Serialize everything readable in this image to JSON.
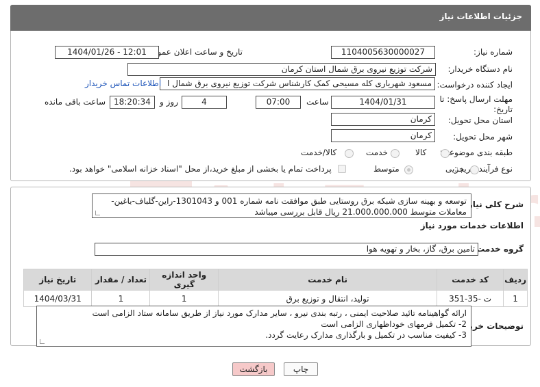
{
  "header": {
    "title": "جزئیات اطلاعات نیاز"
  },
  "form": {
    "need_number_label": "شماره نیاز:",
    "need_number": "1104005630000027",
    "announce_label": "تاریخ و ساعت اعلان عمومی:",
    "announce_value": "1404/01/26 - 12:01",
    "buyer_org_label": "نام دستگاه خریدار:",
    "buyer_org": "شرکت توزیع نیروی برق شمال استان کرمان",
    "creator_label": "ایجاد کننده درخواست:",
    "creator": "مسعود شهریاری کله مسیحی کمک کارشناس شرکت توزیع نیروی برق شمال ا",
    "contact_link": "اطلاعات تماس خریدار",
    "deadline_label_1": "مهلت ارسال پاسخ: تا",
    "deadline_label_2": "تاریخ:",
    "deadline_date": "1404/01/31",
    "time_label": "ساعت",
    "deadline_time": "07:00",
    "day_and_label": "روز و",
    "days": "4",
    "remaining_time": "18:20:34",
    "remaining_label": "ساعت باقی مانده",
    "province_label": "استان محل تحویل:",
    "province": "کرمان",
    "city_label": "شهر محل تحویل:",
    "city": "کرمان",
    "category_label": "طبقه بندی موضوعی:",
    "category_options": [
      "کالا",
      "خدمت",
      "کالا/خدمت"
    ],
    "process_label": "نوع فرآیند خرید :",
    "process_options": [
      "جزیی",
      "متوسط"
    ],
    "payment_note": "پرداخت تمام یا بخشی از مبلغ خرید،از محل \"اسناد خزانه اسلامی\" خواهد بود."
  },
  "description": {
    "label": "شرح کلی نیاز:",
    "line1": "توسعه و بهینه سازی شبکه برق روستایی طبق موافقت نامه شماره 001 و 1301043-راین-گلباف-باغین-",
    "line2": "معاملات متوسط 21.000.000.000 ریال قابل بررسی میباشد"
  },
  "services": {
    "section_title": "اطلاعات خدمات مورد نیاز",
    "group_label": "گروه خدمت:",
    "group_value": "تامین برق، گاز، بخار و تهویه هوا",
    "columns": [
      "ردیف",
      "کد خدمت",
      "نام خدمت",
      "واحد اندازه گیری",
      "تعداد / مقدار",
      "تاریخ نیاز"
    ],
    "rows": [
      [
        "1",
        "ت -35-351",
        "تولید، انتقال و توزیع برق",
        "1",
        "1",
        "1404/03/31"
      ]
    ]
  },
  "buyer_notes": {
    "label": "توضیحات خریدار:",
    "line1": "ارائه گواهینامه تائید صلاحیت ایمنی ، رتبه بندی نیرو ، سایر مدارک مورد نیاز از طریق سامانه ستاد الزامی است",
    "line2": "2- تکمیل فرمهای خوداظهاری الزامی است",
    "line3": "3- کیفیت مناسب در تکمیل و بارگذاری مدارک رعایت گردد."
  },
  "buttons": {
    "print": "چاپ",
    "back": "بازگشت"
  },
  "watermark": {
    "text": "AriaTender.net"
  },
  "colors": {
    "header_bg": "#6d6d6d",
    "link": "#1a52b8",
    "back_button_bg": "#f6c9c9",
    "watermark": "#c0392b"
  }
}
